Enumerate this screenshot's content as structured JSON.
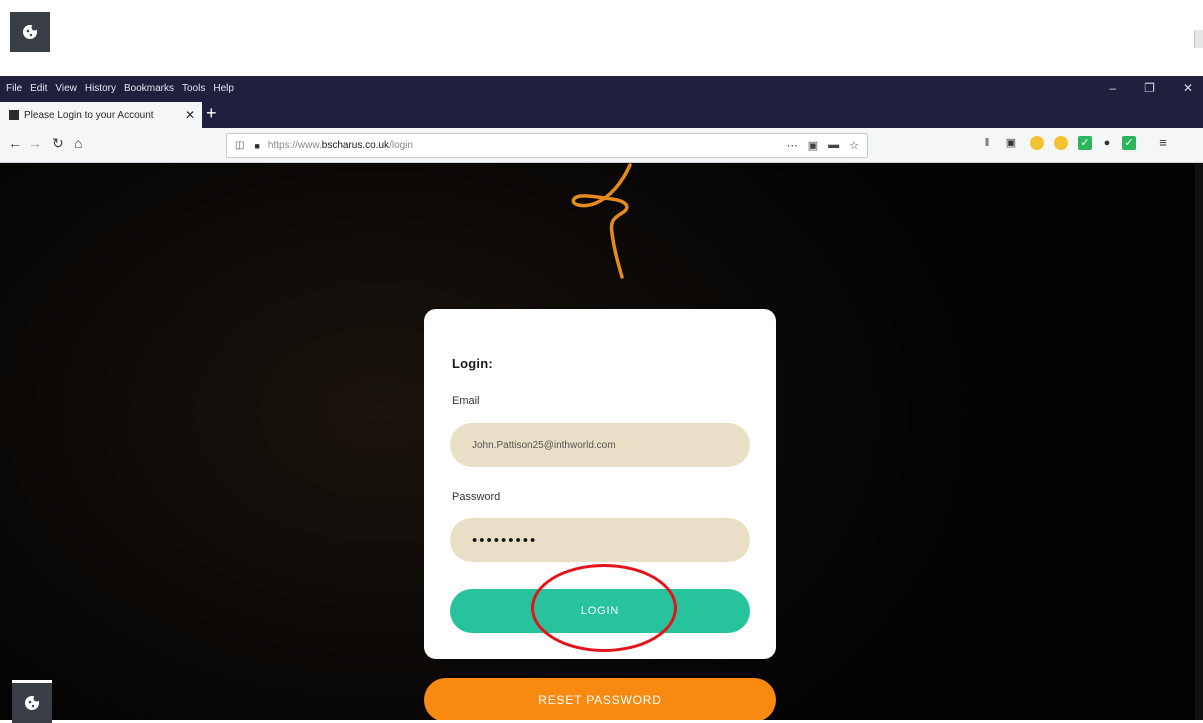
{
  "window": {
    "menu": [
      "File",
      "Edit",
      "View",
      "History",
      "Bookmarks",
      "Tools",
      "Help"
    ],
    "controls": {
      "minimize": "–",
      "restore": "❐",
      "close": "✕"
    }
  },
  "tab": {
    "title": "Please Login to your Account",
    "close": "✕",
    "new_tab": "+"
  },
  "nav": {
    "back": "←",
    "forward": "→",
    "reload": "↻",
    "home": "⌂",
    "url_prefix": "https://www.",
    "url_domain": "bscharus.co.uk",
    "url_path": "/login",
    "page_actions": [
      "⋯",
      "▣",
      "▬",
      "☆"
    ]
  },
  "login": {
    "heading": "Login:",
    "email_label": "Email",
    "email_value": "John.Pattison25@inthworld.com",
    "password_label": "Password",
    "password_value": "•••••••••",
    "login_button": "LOGIN",
    "reset_button": "RESET PASSWORD"
  },
  "colors": {
    "login_button": "#27c39d",
    "reset_button": "#f98a11",
    "field_bg": "#e8dfc6",
    "annotation": "#e3141b",
    "logo": "#e58a1f"
  },
  "icons": {
    "cookie_badge": "cookie-icon",
    "logo": "swirl-logo"
  }
}
